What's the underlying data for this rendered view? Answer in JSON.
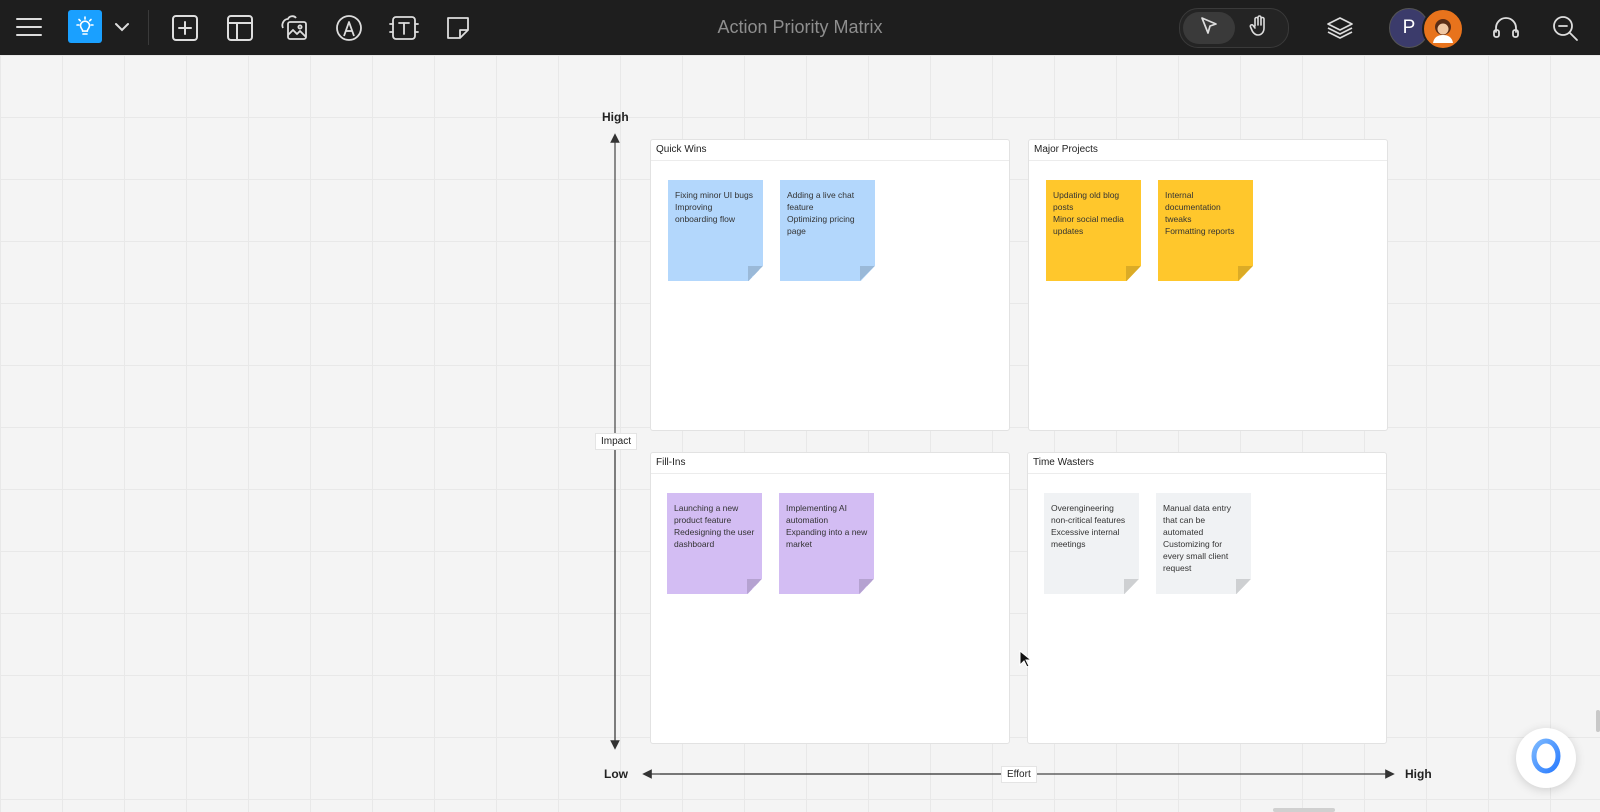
{
  "toolbar": {
    "title": "Action Priority Matrix",
    "accent_color": "#1aa0ff",
    "left_icons": [
      "menu-icon",
      "lightbulb-icon",
      "chevron-down-icon",
      "add-square-icon",
      "layout-icon",
      "image-icon",
      "pen-icon",
      "text-icon",
      "sticky-note-icon"
    ],
    "right_icons": [
      "layers-icon",
      "headset-icon",
      "zoom-out-icon"
    ],
    "mode": {
      "select_icon": "cursor-icon",
      "hand_icon": "hand-icon",
      "active": "select"
    },
    "avatars": [
      {
        "initial": "P",
        "color": "#3b3b6b"
      },
      {
        "initial": "",
        "color": "#e8731c"
      }
    ]
  },
  "matrix": {
    "y_axis": {
      "high": "High",
      "label": "Impact"
    },
    "x_axis": {
      "low": "Low",
      "label": "Effort",
      "high": "High"
    },
    "quadrants": [
      {
        "title": "Quick Wins",
        "color": "#b3d7fc",
        "notes": [
          {
            "lines": [
              "Fixing minor UI bugs",
              "Improving onboarding flow"
            ]
          },
          {
            "lines": [
              "Adding a live chat feature",
              "Optimizing pricing page"
            ]
          }
        ]
      },
      {
        "title": "Major Projects",
        "color": "#ffc72c",
        "notes": [
          {
            "lines": [
              "Updating old blog posts",
              "Minor social media updates"
            ]
          },
          {
            "lines": [
              "Internal documentation tweaks",
              "Formatting reports"
            ]
          }
        ]
      },
      {
        "title": "Fill-Ins",
        "color": "#d3bdf3",
        "notes": [
          {
            "lines": [
              "Launching a new product feature",
              "Redesigning the user dashboard"
            ]
          },
          {
            "lines": [
              "Implementing AI automation",
              "Expanding into a new market"
            ]
          }
        ]
      },
      {
        "title": "Time Wasters",
        "color": "#f0f2f4",
        "notes": [
          {
            "lines": [
              "Overengineering non-critical features",
              "Excessive internal meetings"
            ]
          },
          {
            "lines": [
              "Manual data entry that can be automated",
              "Customizing for every small client request"
            ]
          }
        ]
      }
    ]
  },
  "assistant_button": {
    "icon": "assistant-ring-icon"
  }
}
